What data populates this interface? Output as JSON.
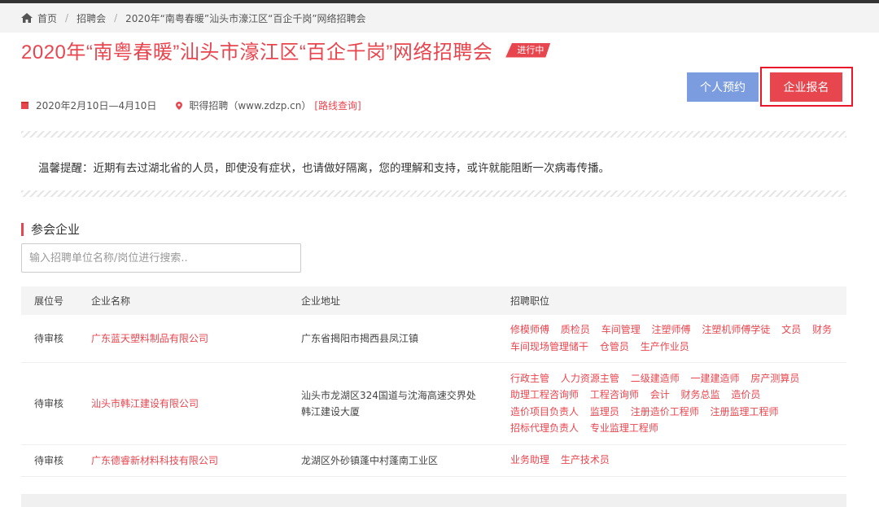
{
  "breadcrumb": {
    "home": "首页",
    "section": "招聘会",
    "current": "2020年“南粤春暖”汕头市濠江区“百企千岗”网络招聘会"
  },
  "fair": {
    "title": "2020年“南粤春暖”汕头市濠江区“百企千岗”网络招聘会",
    "status": "进行中",
    "date": "2020年2月10日—4月10日",
    "location": "职得招聘（www.zdzp.cn）",
    "route_link": "[路线查询]"
  },
  "buttons": {
    "personal": "个人预约",
    "company": "企业报名"
  },
  "notice": "温馨提醒：近期有去过湖北省的人员，即使没有症状，也请做好隔离，您的理解和支持，或许就能阻断一次病毒传播。",
  "section": {
    "title": "参会企业"
  },
  "search": {
    "placeholder": "输入招聘单位名称/岗位进行搜索.."
  },
  "table": {
    "headers": [
      "展位号",
      "企业名称",
      "企业地址",
      "招聘职位"
    ],
    "rows": [
      {
        "booth": "待审核",
        "name": "广东蓝天塑料制品有限公司",
        "address": "广东省揭阳市揭西县凤江镇",
        "positions": [
          "修模师傅",
          "质检员",
          "车间管理",
          "注塑师傅",
          "注塑机师傅学徒",
          "文员",
          "财务",
          "车间现场管理储干",
          "仓管员",
          "生产作业员"
        ]
      },
      {
        "booth": "待审核",
        "name": "汕头市韩江建设有限公司",
        "address": "汕头市龙湖区324国道与沈海高速交界处韩江建设大厦",
        "positions": [
          "行政主管",
          "人力资源主管",
          "二级建造师",
          "一建建造师",
          "房产测算员",
          "助理工程咨询师",
          "工程咨询师",
          "会计",
          "财务总监",
          "造价员",
          "造价项目负责人",
          "监理员",
          "注册造价工程师",
          "注册监理工程师",
          "招标代理负责人",
          "专业监理工程师"
        ]
      },
      {
        "booth": "待审核",
        "name": "广东德睿新材料科技有限公司",
        "address": "龙湖区外砂镇蓬中村蓬南工业区",
        "positions": [
          "业务助理",
          "生产技术员"
        ]
      }
    ]
  },
  "colors": {
    "accent": "#e8464f",
    "personal_button": "#7b9de0",
    "highlight_outline": "#e8172a"
  }
}
